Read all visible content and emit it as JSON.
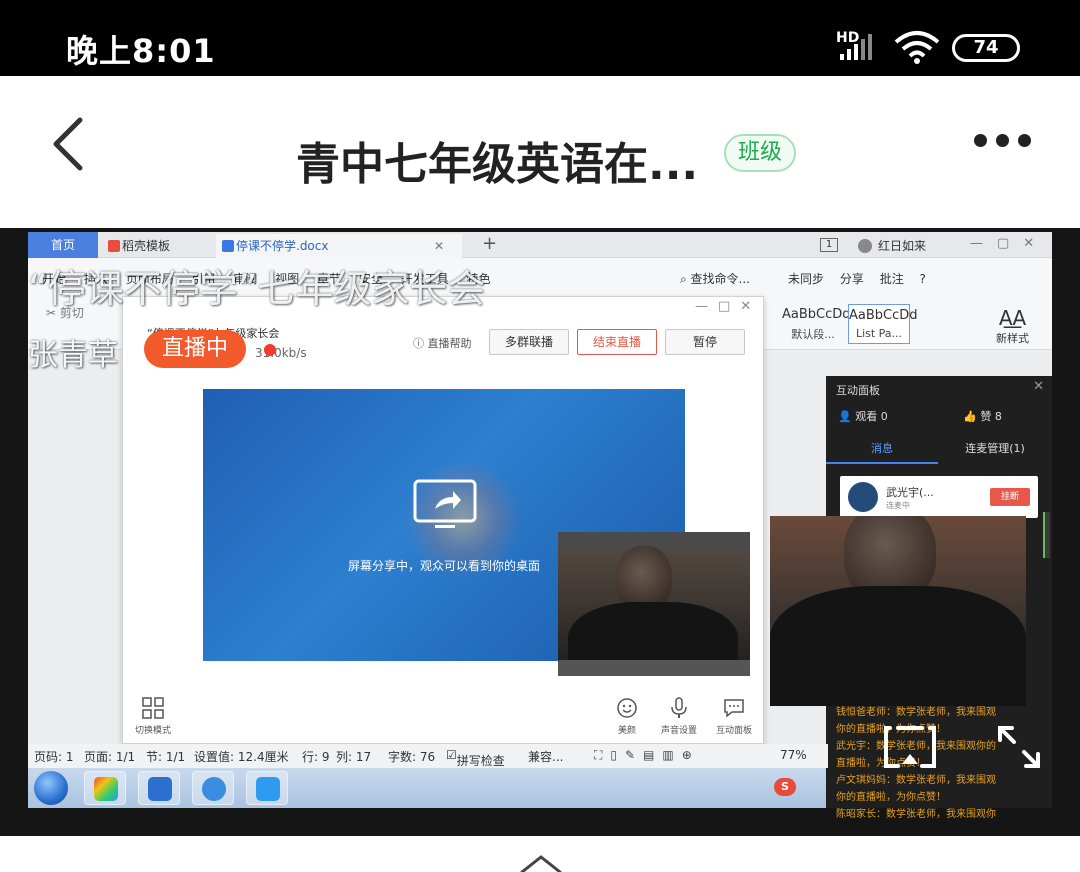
{
  "status_bar": {
    "time": "晚上8:01",
    "network": "HD",
    "battery": "74"
  },
  "header": {
    "title": "青中七年级英语在...",
    "badge": "班级"
  },
  "overlay": {
    "stream_title": "“停课不停学”七年级家长会",
    "host_name": "张青草",
    "live_label": "直播中"
  },
  "wps": {
    "tabs": {
      "home": "首页",
      "template": "稻壳模板",
      "document": "停课不停学.docx"
    },
    "page_count": "1",
    "user": "红日如来",
    "ribbon": {
      "menus": [
        "开始",
        "插入",
        "页面布局",
        "引用",
        "审阅",
        "视图",
        "章节",
        "安全",
        "开发工具",
        "特色"
      ],
      "find": "查找命令...",
      "sync": "未同步",
      "share": "分享",
      "comment": "批注",
      "cut": "剪切",
      "styles": [
        {
          "preview": "AaBbCcDd",
          "name": "默认段..."
        },
        {
          "preview": "AaBbCcDd",
          "name": "List Pa..."
        }
      ],
      "new_style": "新样式"
    },
    "status": {
      "page_num": "页码: 1",
      "pages": "页面: 1/1",
      "section": "节: 1/1",
      "setting": "设置值: 12.4厘米",
      "row": "行: 9",
      "col": "列: 17",
      "words": "字数: 76",
      "spell": "拼写检查",
      "compat": "兼容...",
      "zoom": "77%"
    }
  },
  "live_dialog": {
    "title": "“停课不停学”七年级家长会",
    "speed": "31.0kb/s",
    "help": "直播帮助",
    "buttons": {
      "multi_group": "多群联播",
      "end": "结束直播",
      "pause": "暂停"
    },
    "screen_share_text": "屏幕分享中，观众可以看到你的桌面",
    "footer": {
      "switch_mode": "切换模式",
      "beauty": "美颜",
      "audio": "声音设置",
      "interact": "互动面板"
    }
  },
  "panel": {
    "title": "互动面板",
    "viewers": "观看 0",
    "likes": "赞 8",
    "tabs": {
      "messages": "消息",
      "connection": "连麦管理(1)"
    },
    "caller": {
      "name": "武光宇(...",
      "status": "连麦中",
      "hangup": "挂断"
    },
    "chat": [
      "钱恒爸老师：数学张老师，我来围观",
      "你的直播啦，为你点赞！",
      "武光宇：数学张老师，我来围观你的",
      "直播啦，为你点赞！",
      "卢文琪妈妈：数学张老师，我来围观",
      "你的直播啦，为你点赞！",
      "陈昭家长：数学张老师，我来围观你"
    ]
  },
  "colors": {
    "accent_green": "#1aad4a",
    "live_orange": "#f25a2c",
    "wps_blue": "#4a7fe0",
    "end_red": "#e7584a"
  }
}
